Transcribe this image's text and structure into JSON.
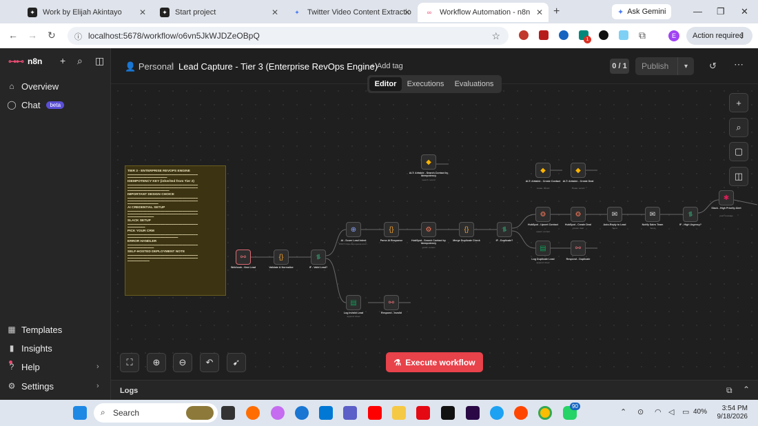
{
  "browser": {
    "tabs": [
      {
        "title": "Work by Elijah Akintayo"
      },
      {
        "title": "Start project"
      },
      {
        "title": "Twitter Video Content Extractio"
      },
      {
        "title": "Workflow Automation - n8n"
      }
    ],
    "ask_gemini": "Ask Gemini",
    "url": "localhost:5678/workflow/o6vn5JkWJDZeOBpQ",
    "action_required": "Action required",
    "profile_initial": "E",
    "ext_badge": "1"
  },
  "sidebar": {
    "brand": "n8n",
    "top_items": [
      {
        "label": "Overview"
      },
      {
        "label": "Chat",
        "badge": "beta"
      }
    ],
    "bottom_items": [
      {
        "label": "Templates"
      },
      {
        "label": "Insights"
      },
      {
        "label": "Help"
      },
      {
        "label": "Settings"
      }
    ]
  },
  "header": {
    "project": "Personal",
    "workflow_name": "Lead Capture - Tier 3 (Enterprise RevOps Engine)",
    "add_tag": "+ Add tag",
    "version_counter": "0 / 1",
    "publish": "Publish",
    "tabs": [
      "Editor",
      "Executions",
      "Evaluations"
    ],
    "active_tab": "Editor"
  },
  "sticky_note": {
    "title": "TIER 3 - ENTERPRISE REVOPS ENGINE",
    "sections": [
      {
        "heading": "IDEMPOTENCY KEY (inherited from Tier 2)"
      },
      {
        "heading": "IMPORTANT DESIGN CHOICE"
      },
      {
        "heading": "AI CREDENTIAL SETUP"
      },
      {
        "heading": "SLACK SETUP"
      },
      {
        "heading": "PICK YOUR CRM"
      },
      {
        "heading": "ERROR HANDLER"
      },
      {
        "heading": "SELF-HOSTED DEPLOYMENT NOTE"
      }
    ]
  },
  "nodes": [
    {
      "id": "webhook",
      "label": "Webhook - New Lead",
      "sub": ""
    },
    {
      "id": "validate",
      "label": "Validate & Normalize",
      "sub": ""
    },
    {
      "id": "if-valid",
      "label": "IF - Valid Lead?",
      "sub": ""
    },
    {
      "id": "ai-score",
      "label": "AI - Score Lead Intent",
      "sub": "POST: https://api.openai.com/..."
    },
    {
      "id": "parse-ai",
      "label": "Parse AI Response",
      "sub": ""
    },
    {
      "id": "hubspot-search",
      "label": "HubSpot - Search Contact by Idempotency",
      "sub": "getAll: contact"
    },
    {
      "id": "merge-dup",
      "label": "Merge Duplicate Check",
      "sub": ""
    },
    {
      "id": "if-dup",
      "label": "IF - Duplicate?",
      "sub": ""
    },
    {
      "id": "alt-airtable-search",
      "label": "ALT: Airtable - Search Contact by Idempotency",
      "sub": "search: record"
    },
    {
      "id": "alt-airtable-create-contact",
      "label": "ALT: Airtable - Create Contact",
      "sub": "create: record"
    },
    {
      "id": "alt-airtable-create-deal",
      "label": "ALT: Airtable - Create Deal",
      "sub": "create: record"
    },
    {
      "id": "hubspot-upsert",
      "label": "HubSpot - Upsert Contact",
      "sub": "upsert: contact"
    },
    {
      "id": "hubspot-deal",
      "label": "HubSpot - Create Deal",
      "sub": "create: deal"
    },
    {
      "id": "auto-reply",
      "label": "Auto-Reply to Lead",
      "sub": "Send"
    },
    {
      "id": "notify-sales",
      "label": "Notify Sales Team",
      "sub": "Send"
    },
    {
      "id": "if-urgency",
      "label": "IF - High Urgency?",
      "sub": ""
    },
    {
      "id": "slack-alert",
      "label": "Slack - High Priority Alert",
      "sub": "post: message"
    },
    {
      "id": "log-dup",
      "label": "Log Duplicate Lead",
      "sub": "append: sheet"
    },
    {
      "id": "respond-dup",
      "label": "Respond - Duplicate",
      "sub": ""
    },
    {
      "id": "log-invalid",
      "label": "Log Invalid Lead",
      "sub": "append: sheet"
    },
    {
      "id": "respond-invalid",
      "label": "Respond - Invalid",
      "sub": ""
    }
  ],
  "canvas": {
    "execute": "Execute workflow"
  },
  "logs": {
    "label": "Logs"
  },
  "taskbar": {
    "search": "Search",
    "time": "3:54 PM",
    "date": "9/18/2026",
    "battery": "40%",
    "whatsapp_badge": "90"
  }
}
